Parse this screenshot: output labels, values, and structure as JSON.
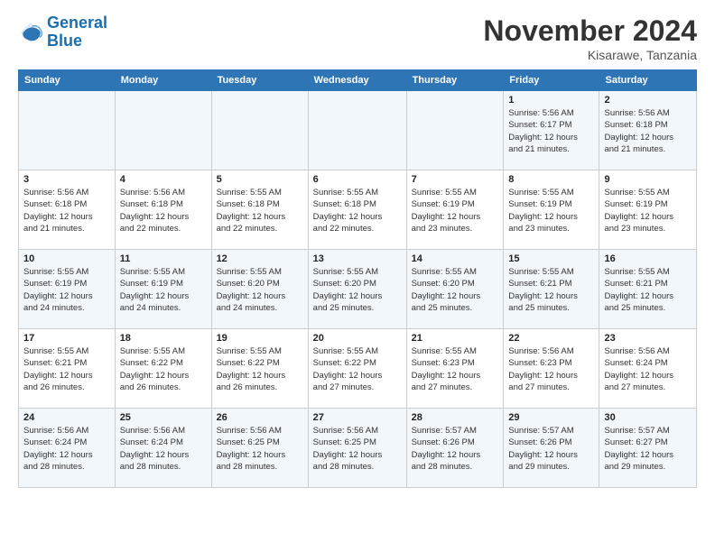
{
  "header": {
    "logo_line1": "General",
    "logo_line2": "Blue",
    "month_title": "November 2024",
    "location": "Kisarawe, Tanzania"
  },
  "weekdays": [
    "Sunday",
    "Monday",
    "Tuesday",
    "Wednesday",
    "Thursday",
    "Friday",
    "Saturday"
  ],
  "weeks": [
    [
      {
        "day": "",
        "info": ""
      },
      {
        "day": "",
        "info": ""
      },
      {
        "day": "",
        "info": ""
      },
      {
        "day": "",
        "info": ""
      },
      {
        "day": "",
        "info": ""
      },
      {
        "day": "1",
        "info": "Sunrise: 5:56 AM\nSunset: 6:17 PM\nDaylight: 12 hours\nand 21 minutes."
      },
      {
        "day": "2",
        "info": "Sunrise: 5:56 AM\nSunset: 6:18 PM\nDaylight: 12 hours\nand 21 minutes."
      }
    ],
    [
      {
        "day": "3",
        "info": "Sunrise: 5:56 AM\nSunset: 6:18 PM\nDaylight: 12 hours\nand 21 minutes."
      },
      {
        "day": "4",
        "info": "Sunrise: 5:56 AM\nSunset: 6:18 PM\nDaylight: 12 hours\nand 22 minutes."
      },
      {
        "day": "5",
        "info": "Sunrise: 5:55 AM\nSunset: 6:18 PM\nDaylight: 12 hours\nand 22 minutes."
      },
      {
        "day": "6",
        "info": "Sunrise: 5:55 AM\nSunset: 6:18 PM\nDaylight: 12 hours\nand 22 minutes."
      },
      {
        "day": "7",
        "info": "Sunrise: 5:55 AM\nSunset: 6:19 PM\nDaylight: 12 hours\nand 23 minutes."
      },
      {
        "day": "8",
        "info": "Sunrise: 5:55 AM\nSunset: 6:19 PM\nDaylight: 12 hours\nand 23 minutes."
      },
      {
        "day": "9",
        "info": "Sunrise: 5:55 AM\nSunset: 6:19 PM\nDaylight: 12 hours\nand 23 minutes."
      }
    ],
    [
      {
        "day": "10",
        "info": "Sunrise: 5:55 AM\nSunset: 6:19 PM\nDaylight: 12 hours\nand 24 minutes."
      },
      {
        "day": "11",
        "info": "Sunrise: 5:55 AM\nSunset: 6:19 PM\nDaylight: 12 hours\nand 24 minutes."
      },
      {
        "day": "12",
        "info": "Sunrise: 5:55 AM\nSunset: 6:20 PM\nDaylight: 12 hours\nand 24 minutes."
      },
      {
        "day": "13",
        "info": "Sunrise: 5:55 AM\nSunset: 6:20 PM\nDaylight: 12 hours\nand 25 minutes."
      },
      {
        "day": "14",
        "info": "Sunrise: 5:55 AM\nSunset: 6:20 PM\nDaylight: 12 hours\nand 25 minutes."
      },
      {
        "day": "15",
        "info": "Sunrise: 5:55 AM\nSunset: 6:21 PM\nDaylight: 12 hours\nand 25 minutes."
      },
      {
        "day": "16",
        "info": "Sunrise: 5:55 AM\nSunset: 6:21 PM\nDaylight: 12 hours\nand 25 minutes."
      }
    ],
    [
      {
        "day": "17",
        "info": "Sunrise: 5:55 AM\nSunset: 6:21 PM\nDaylight: 12 hours\nand 26 minutes."
      },
      {
        "day": "18",
        "info": "Sunrise: 5:55 AM\nSunset: 6:22 PM\nDaylight: 12 hours\nand 26 minutes."
      },
      {
        "day": "19",
        "info": "Sunrise: 5:55 AM\nSunset: 6:22 PM\nDaylight: 12 hours\nand 26 minutes."
      },
      {
        "day": "20",
        "info": "Sunrise: 5:55 AM\nSunset: 6:22 PM\nDaylight: 12 hours\nand 27 minutes."
      },
      {
        "day": "21",
        "info": "Sunrise: 5:55 AM\nSunset: 6:23 PM\nDaylight: 12 hours\nand 27 minutes."
      },
      {
        "day": "22",
        "info": "Sunrise: 5:56 AM\nSunset: 6:23 PM\nDaylight: 12 hours\nand 27 minutes."
      },
      {
        "day": "23",
        "info": "Sunrise: 5:56 AM\nSunset: 6:24 PM\nDaylight: 12 hours\nand 27 minutes."
      }
    ],
    [
      {
        "day": "24",
        "info": "Sunrise: 5:56 AM\nSunset: 6:24 PM\nDaylight: 12 hours\nand 28 minutes."
      },
      {
        "day": "25",
        "info": "Sunrise: 5:56 AM\nSunset: 6:24 PM\nDaylight: 12 hours\nand 28 minutes."
      },
      {
        "day": "26",
        "info": "Sunrise: 5:56 AM\nSunset: 6:25 PM\nDaylight: 12 hours\nand 28 minutes."
      },
      {
        "day": "27",
        "info": "Sunrise: 5:56 AM\nSunset: 6:25 PM\nDaylight: 12 hours\nand 28 minutes."
      },
      {
        "day": "28",
        "info": "Sunrise: 5:57 AM\nSunset: 6:26 PM\nDaylight: 12 hours\nand 28 minutes."
      },
      {
        "day": "29",
        "info": "Sunrise: 5:57 AM\nSunset: 6:26 PM\nDaylight: 12 hours\nand 29 minutes."
      },
      {
        "day": "30",
        "info": "Sunrise: 5:57 AM\nSunset: 6:27 PM\nDaylight: 12 hours\nand 29 minutes."
      }
    ]
  ]
}
